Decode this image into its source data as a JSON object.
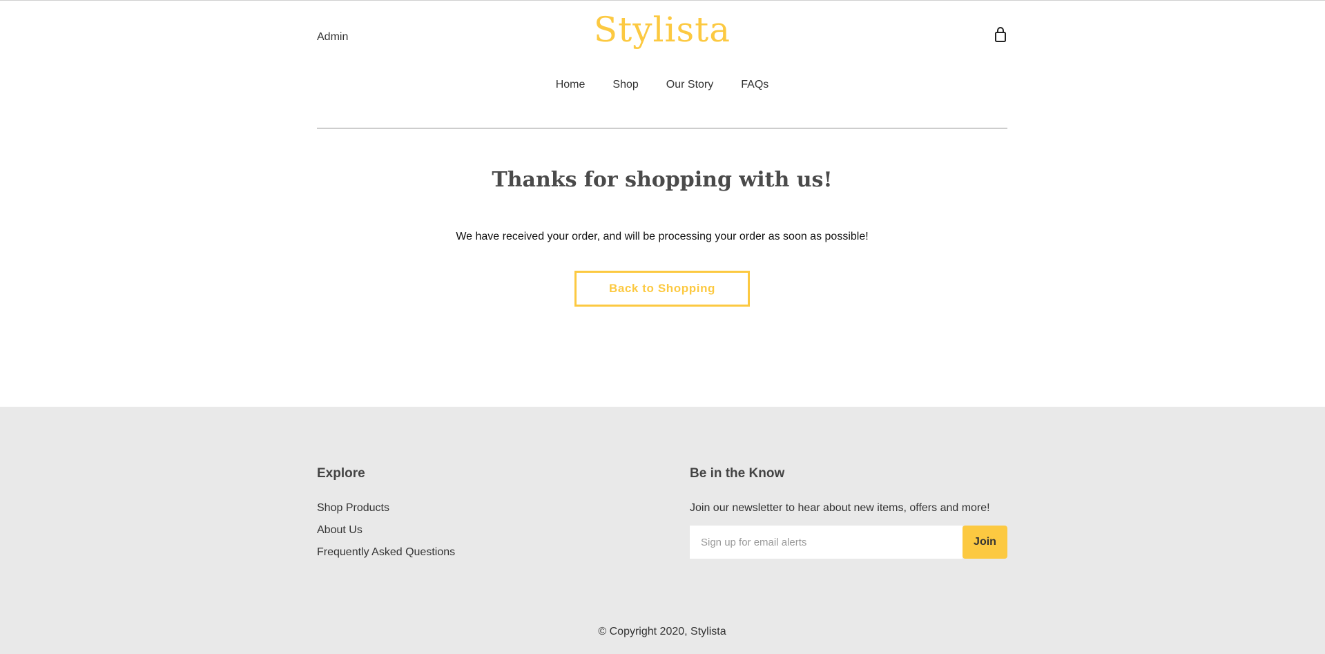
{
  "header": {
    "admin_label": "Admin",
    "logo_text": "Stylista",
    "cart_icon": "shopping-bag-icon",
    "nav": [
      {
        "label": "Home"
      },
      {
        "label": "Shop"
      },
      {
        "label": "Our Story"
      },
      {
        "label": "FAQs"
      }
    ]
  },
  "main": {
    "title": "Thanks for shopping with us!",
    "message": "We have received your order, and will be processing your order as soon as possible!",
    "back_button": "Back to Shopping"
  },
  "footer": {
    "explore": {
      "title": "Explore",
      "links": [
        {
          "label": "Shop Products"
        },
        {
          "label": "About Us"
        },
        {
          "label": "Frequently Asked Questions"
        }
      ]
    },
    "newsletter": {
      "title": "Be in the Know",
      "text": "Join our newsletter to hear about new items, offers and more!",
      "placeholder": "Sign up for email alerts",
      "value": "",
      "join_label": "Join"
    },
    "copyright": "© Copyright 2020, Stylista"
  },
  "colors": {
    "accent": "#fcc941",
    "footer_bg": "#e9e9e9",
    "text": "#333333"
  }
}
